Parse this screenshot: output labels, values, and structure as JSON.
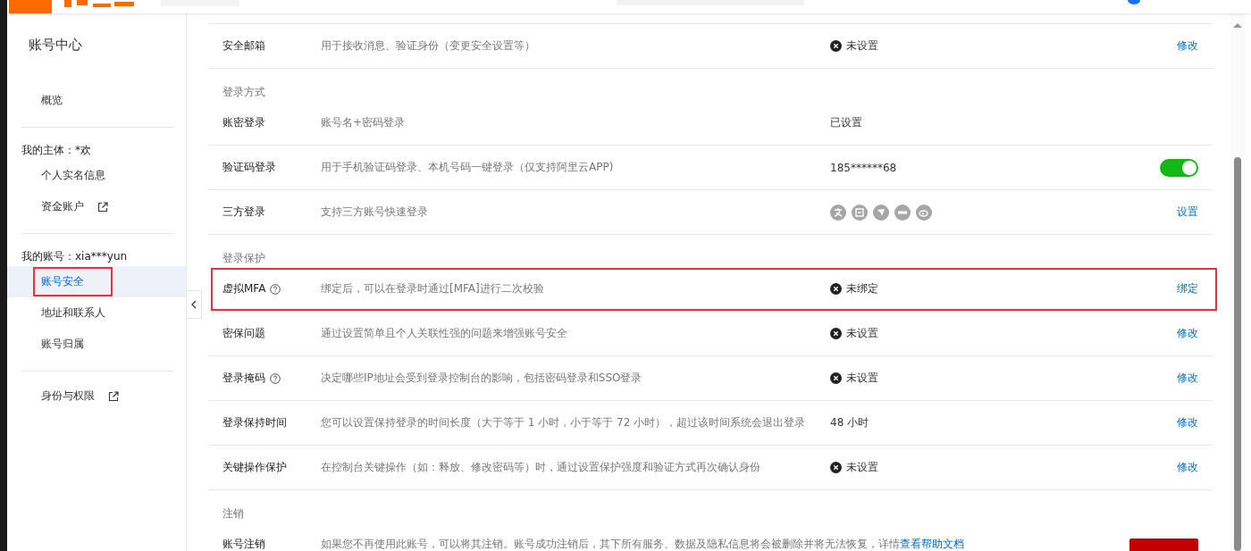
{
  "sidebar": {
    "title": "账号中心",
    "groups": [
      {
        "items": [
          {
            "label": "概览",
            "external": false,
            "selected": false,
            "highlighted": false
          }
        ]
      },
      {
        "heading": "我的主体：*欢",
        "items": [
          {
            "label": "个人实名信息",
            "external": false,
            "selected": false,
            "highlighted": false
          },
          {
            "label": "资金账户",
            "external": true,
            "selected": false,
            "highlighted": false
          }
        ]
      },
      {
        "heading": "我的账号：xia***yun",
        "items": [
          {
            "label": "账号安全",
            "external": false,
            "selected": true,
            "highlighted": true
          },
          {
            "label": "地址和联系人",
            "external": false,
            "selected": false,
            "highlighted": false
          },
          {
            "label": "账号归属",
            "external": false,
            "selected": false,
            "highlighted": false
          }
        ]
      },
      {
        "items": [
          {
            "label": "身份与权限",
            "external": true,
            "selected": false,
            "highlighted": false
          }
        ]
      }
    ]
  },
  "sections": [
    {
      "rows": [
        {
          "label": "安全邮箱",
          "help": false,
          "highlighted": false,
          "description": "用于接收消息、验证身份（变更安全设置等）",
          "status": {
            "kind": "unset",
            "text": "未设置"
          },
          "action": {
            "kind": "link",
            "label": "修改"
          }
        }
      ]
    },
    {
      "title": "登录方式",
      "rows": [
        {
          "label": "账密登录",
          "help": false,
          "highlighted": false,
          "description": "账号名+密码登录",
          "status": {
            "kind": "plain",
            "text": "已设置"
          }
        },
        {
          "label": "验证码登录",
          "help": false,
          "highlighted": false,
          "description": "用于手机验证码登录、本机号码一键登录（仅支持阿里云APP)",
          "status": {
            "kind": "plain",
            "text": "185******68"
          },
          "action": {
            "kind": "toggle",
            "on": true
          }
        },
        {
          "label": "三方登录",
          "help": false,
          "highlighted": false,
          "description": "支持三方账号快速登录",
          "status": {
            "kind": "icons"
          },
          "action": {
            "kind": "link",
            "label": "设置"
          }
        }
      ]
    },
    {
      "title": "登录保护",
      "rows": [
        {
          "label": "虚拟MFA",
          "help": true,
          "highlighted": true,
          "description": "绑定后，可以在登录时通过[MFA]进行二次校验",
          "status": {
            "kind": "unset",
            "text": "未绑定"
          },
          "action": {
            "kind": "link",
            "label": "绑定"
          }
        },
        {
          "label": "密保问题",
          "help": false,
          "highlighted": false,
          "description": "通过设置简单且个人关联性强的问题来增强账号安全",
          "status": {
            "kind": "unset",
            "text": "未设置"
          },
          "action": {
            "kind": "link",
            "label": "修改"
          }
        },
        {
          "label": "登录掩码",
          "help": true,
          "highlighted": false,
          "description": "决定哪些IP地址会受到登录控制台的影响，包括密码登录和SSO登录",
          "status": {
            "kind": "unset",
            "text": "未设置"
          },
          "action": {
            "kind": "link",
            "label": "修改"
          }
        },
        {
          "label": "登录保持时间",
          "help": false,
          "highlighted": false,
          "description": "您可以设置保持登录的时间长度（大于等于 1 小时，小于等于 72 小时），超过该时间系统会退出登录",
          "status": {
            "kind": "plain",
            "text": "48 小时"
          },
          "action": {
            "kind": "link",
            "label": "修改"
          }
        },
        {
          "label": "关键操作保护",
          "help": false,
          "highlighted": false,
          "description": "在控制台关键操作（如：释放、修改密码等）时，通过设置保护强度和验证方式再次确认身份",
          "status": {
            "kind": "unset",
            "text": "未设置"
          },
          "action": {
            "kind": "link",
            "label": "修改"
          }
        }
      ]
    },
    {
      "title": "注销",
      "rows": [
        {
          "label": "账号注销",
          "help": false,
          "highlighted": false,
          "description": "如果您不再使用此账号，可以将其注销。账号成功注销后，其下所有服务、数据及隐私信息将会被删除并将无法恢复，详情",
          "link": "查看帮助文档",
          "action": {
            "kind": "danger_button"
          }
        }
      ]
    }
  ]
}
